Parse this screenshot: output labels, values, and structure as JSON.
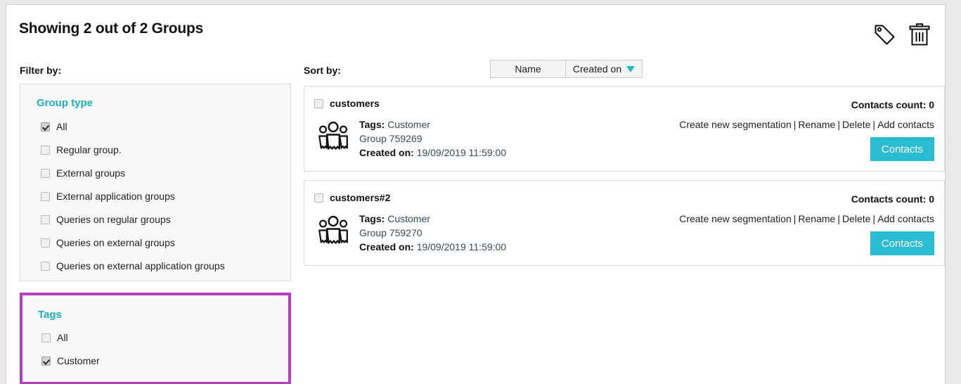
{
  "header": {
    "title": "Showing 2 out of 2 Groups",
    "icons": [
      {
        "name": "tag-icon",
        "label": "Tag"
      },
      {
        "name": "trash-icon",
        "label": "Delete"
      }
    ]
  },
  "filter": {
    "label": "Filter by:",
    "group_type": {
      "heading": "Group type",
      "options": [
        {
          "label": "All",
          "checked": true
        },
        {
          "label": "Regular group.",
          "checked": false
        },
        {
          "label": "External groups",
          "checked": false
        },
        {
          "label": "External application groups",
          "checked": false
        },
        {
          "label": "Queries on regular groups",
          "checked": false
        },
        {
          "label": "Queries on external groups",
          "checked": false
        },
        {
          "label": "Queries on external application groups",
          "checked": false
        }
      ]
    },
    "tags": {
      "heading": "Tags",
      "highlighted": true,
      "highlight_color": "#b83ec0",
      "options": [
        {
          "label": "All",
          "checked": false
        },
        {
          "label": "Customer",
          "checked": true
        }
      ]
    }
  },
  "sort": {
    "label": "Sort by:",
    "options": [
      {
        "label": "Name",
        "active": false,
        "caret": false
      },
      {
        "label": "Created on",
        "active": true,
        "caret": true
      }
    ]
  },
  "groups": [
    {
      "name": "customers",
      "selected": false,
      "tags_label": "Tags:",
      "tags_value": "Customer",
      "group_id": "Group 759269",
      "created_label": "Created on:",
      "created_value": "19/09/2019 11:59:00",
      "contacts_count": "Contacts count: 0",
      "links": [
        "Create new segmentation",
        "Rename",
        "Delete",
        "Add contacts"
      ],
      "button_label": "Contacts"
    },
    {
      "name": "customers#2",
      "selected": false,
      "tags_label": "Tags:",
      "tags_value": "Customer",
      "group_id": "Group 759270",
      "created_label": "Created on:",
      "created_value": "19/09/2019 11:59:00",
      "contacts_count": "Contacts count: 0",
      "links": [
        "Create new segmentation",
        "Rename",
        "Delete",
        "Add contacts"
      ],
      "button_label": "Contacts"
    }
  ],
  "colors": {
    "accent_teal": "#18b0c8",
    "button_teal": "#29bdd4",
    "highlight_purple": "#b83ec0"
  }
}
